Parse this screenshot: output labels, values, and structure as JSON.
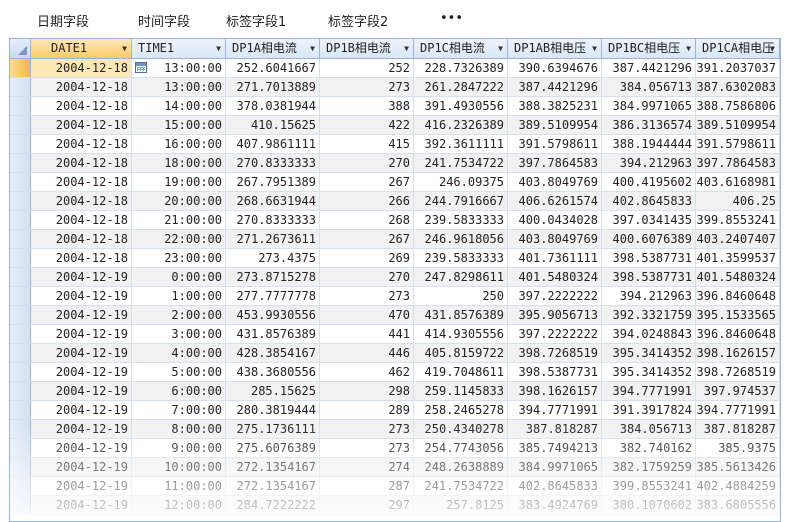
{
  "ribbon": {
    "tabs": [
      "日期字段",
      "时间字段",
      "标签字段1",
      "标签字段2"
    ],
    "more": "•••"
  },
  "grid": {
    "columns": [
      {
        "label": "DATE1",
        "dd": "▼"
      },
      {
        "label": "TIME1",
        "dd": "▼"
      },
      {
        "label": "DP1A相电流",
        "dd": "▼"
      },
      {
        "label": "DP1B相电流",
        "dd": "▼"
      },
      {
        "label": "DP1C相电流",
        "dd": "▼"
      },
      {
        "label": "DP1AB相电压",
        "dd": "▼"
      },
      {
        "label": "DP1BC相电压",
        "dd": "▼"
      },
      {
        "label": "DP1CA相电压",
        "dd": "▼"
      }
    ],
    "rows": [
      [
        "2004-12-18",
        "13:00:00",
        "252.6041667",
        "252",
        "228.7326389",
        "390.6394676",
        "387.4421296",
        "391.2037037"
      ],
      [
        "2004-12-18",
        "13:00:00",
        "271.7013889",
        "273",
        "261.2847222",
        "387.4421296",
        "384.056713",
        "387.6302083"
      ],
      [
        "2004-12-18",
        "14:00:00",
        "378.0381944",
        "388",
        "391.4930556",
        "388.3825231",
        "384.9971065",
        "388.7586806"
      ],
      [
        "2004-12-18",
        "15:00:00",
        "410.15625",
        "422",
        "416.2326389",
        "389.5109954",
        "386.3136574",
        "389.5109954"
      ],
      [
        "2004-12-18",
        "16:00:00",
        "407.9861111",
        "415",
        "392.3611111",
        "391.5798611",
        "388.1944444",
        "391.5798611"
      ],
      [
        "2004-12-18",
        "18:00:00",
        "270.8333333",
        "270",
        "241.7534722",
        "397.7864583",
        "394.212963",
        "397.7864583"
      ],
      [
        "2004-12-18",
        "19:00:00",
        "267.7951389",
        "267",
        "246.09375",
        "403.8049769",
        "400.4195602",
        "403.6168981"
      ],
      [
        "2004-12-18",
        "20:00:00",
        "268.6631944",
        "266",
        "244.7916667",
        "406.6261574",
        "402.8645833",
        "406.25"
      ],
      [
        "2004-12-18",
        "21:00:00",
        "270.8333333",
        "268",
        "239.5833333",
        "400.0434028",
        "397.0341435",
        "399.8553241"
      ],
      [
        "2004-12-18",
        "22:00:00",
        "271.2673611",
        "267",
        "246.9618056",
        "403.8049769",
        "400.6076389",
        "403.2407407"
      ],
      [
        "2004-12-18",
        "23:00:00",
        "273.4375",
        "269",
        "239.5833333",
        "401.7361111",
        "398.5387731",
        "401.3599537"
      ],
      [
        "2004-12-19",
        "0:00:00",
        "273.8715278",
        "270",
        "247.8298611",
        "401.5480324",
        "398.5387731",
        "401.5480324"
      ],
      [
        "2004-12-19",
        "1:00:00",
        "277.7777778",
        "273",
        "250",
        "397.2222222",
        "394.212963",
        "396.8460648"
      ],
      [
        "2004-12-19",
        "2:00:00",
        "453.9930556",
        "470",
        "431.8576389",
        "395.9056713",
        "392.3321759",
        "395.1533565"
      ],
      [
        "2004-12-19",
        "3:00:00",
        "431.8576389",
        "441",
        "414.9305556",
        "397.2222222",
        "394.0248843",
        "396.8460648"
      ],
      [
        "2004-12-19",
        "4:00:00",
        "428.3854167",
        "446",
        "405.8159722",
        "398.7268519",
        "395.3414352",
        "398.1626157"
      ],
      [
        "2004-12-19",
        "5:00:00",
        "438.3680556",
        "462",
        "419.7048611",
        "398.5387731",
        "395.3414352",
        "398.7268519"
      ],
      [
        "2004-12-19",
        "6:00:00",
        "285.15625",
        "298",
        "259.1145833",
        "398.1626157",
        "394.7771991",
        "397.974537"
      ],
      [
        "2004-12-19",
        "7:00:00",
        "280.3819444",
        "289",
        "258.2465278",
        "394.7771991",
        "391.3917824",
        "394.7771991"
      ],
      [
        "2004-12-19",
        "8:00:00",
        "275.1736111",
        "273",
        "250.4340278",
        "387.818287",
        "384.056713",
        "387.818287"
      ],
      [
        "2004-12-19",
        "9:00:00",
        "275.6076389",
        "273",
        "254.7743056",
        "385.7494213",
        "382.740162",
        "385.9375"
      ],
      [
        "2004-12-19",
        "10:00:00",
        "272.1354167",
        "274",
        "248.2638889",
        "384.9971065",
        "382.1759259",
        "385.5613426"
      ],
      [
        "2004-12-19",
        "11:00:00",
        "272.1354167",
        "287",
        "241.7534722",
        "402.8645833",
        "399.8553241",
        "402.4884259"
      ],
      [
        "2004-12-19",
        "12:00:00",
        "284.7222222",
        "297",
        "257.8125",
        "383.4924769",
        "380.1070602",
        "383.6805556"
      ]
    ]
  }
}
